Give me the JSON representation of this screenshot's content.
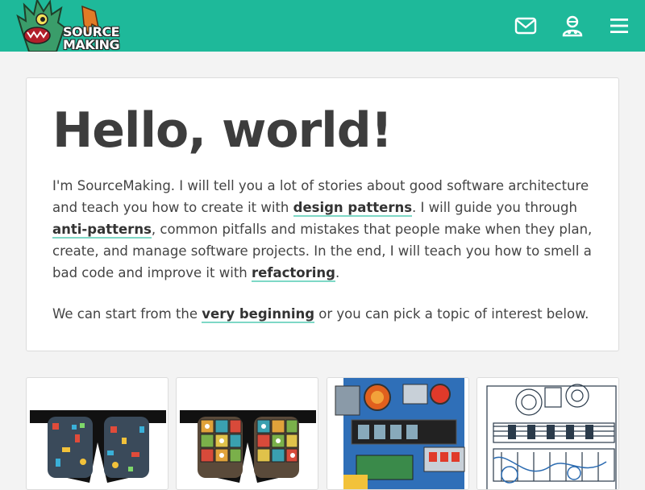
{
  "header": {
    "logo": {
      "line1": "SOURCE",
      "line2": "MAKING"
    },
    "icons": [
      "mail-icon",
      "user-icon",
      "menu-icon"
    ],
    "bg_color": "#1eb99a"
  },
  "hero": {
    "title": "Hello, world!",
    "para1": {
      "t1": "I'm SourceMaking. I will tell you a lot of stories about good software architecture and teach you how to create it with ",
      "link1": "design patterns",
      "t2": ". I will guide you through ",
      "link2": "anti-patterns",
      "t3": ", common pitfalls and mistakes that people make when they plan, create, and manage software projects. In the end, I will teach you how to smell a bad code and improve it with ",
      "link3": "refactoring",
      "t4": "."
    },
    "para2": {
      "t1": "We can start from the ",
      "link1": "very beginning",
      "t2": " or you can pick a topic of interest below."
    },
    "link_underline_color": "#7ed8c6"
  },
  "tiles": [
    {
      "name": "design-patterns-tile",
      "art": "glasses-circuit"
    },
    {
      "name": "anti-patterns-tile",
      "art": "glasses-robots"
    },
    {
      "name": "refactoring-tile",
      "art": "robot-color"
    },
    {
      "name": "uml-tile",
      "art": "robot-sketch"
    }
  ]
}
